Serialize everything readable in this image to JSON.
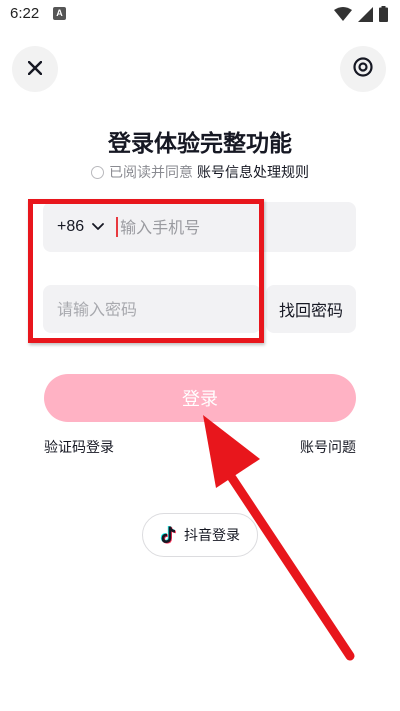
{
  "status_bar": {
    "time": "6:22",
    "notification_badge": "A",
    "icons": [
      "wifi-icon",
      "signal-icon",
      "battery-icon"
    ]
  },
  "header": {
    "close_icon": "close-icon",
    "settings_icon": "settings-icon"
  },
  "login": {
    "title": "登录体验完整功能",
    "agreement_prefix": "已阅读并同意",
    "agreement_link": "账号信息处理规则",
    "country_code": "+86",
    "phone_placeholder": "输入手机号",
    "password_placeholder": "请输入密码",
    "forgot_password": "找回密码",
    "login_button": "登录",
    "sms_login": "验证码登录",
    "account_issue": "账号问题",
    "douyin_login": "抖音登录"
  },
  "colors": {
    "login_button_bg": "#ffb2c4",
    "annotation_red": "#e8161c",
    "field_bg": "#f2f2f4"
  }
}
